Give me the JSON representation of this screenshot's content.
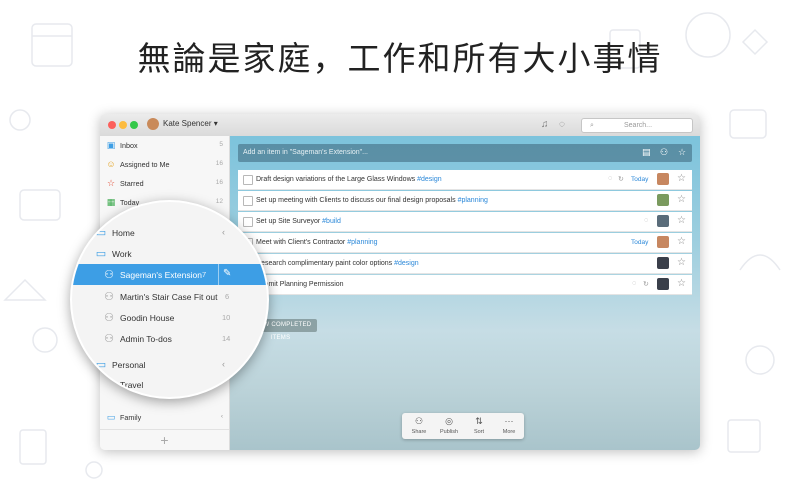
{
  "headline": "無論是家庭，工作和所有大小事情",
  "window": {
    "user": "Kate Spencer",
    "search_placeholder": "Search...",
    "colors": {
      "close": "#fc605c",
      "minimize": "#fdbc40",
      "zoom": "#34c84a",
      "accent": "#3d9ee5",
      "tag": "#2b88d9"
    }
  },
  "sidebar": {
    "items": [
      {
        "label": "Inbox",
        "count": "5",
        "icon": "inbox-icon"
      },
      {
        "label": "Assigned to Me",
        "count": "16",
        "icon": "person-icon"
      },
      {
        "label": "Starred",
        "count": "16",
        "icon": "star-icon"
      },
      {
        "label": "Today",
        "count": "12",
        "icon": "calendar-icon"
      }
    ],
    "bottom": [
      {
        "label": "Family",
        "icon": "folder-icon"
      }
    ],
    "add_label": "+"
  },
  "magnifier": {
    "items": [
      {
        "label": "Home",
        "type": "folder"
      },
      {
        "label": "Work",
        "type": "folder"
      },
      {
        "label": "Sageman's Extension",
        "count": "7",
        "type": "shared-list",
        "selected": true
      },
      {
        "label": "Martin's Stair Case Fit out",
        "count": "6",
        "type": "shared-list"
      },
      {
        "label": "Goodin House",
        "count": "10",
        "type": "shared-list"
      },
      {
        "label": "Admin To-dos",
        "count": "14",
        "type": "shared-list"
      },
      {
        "label": "Personal",
        "type": "folder"
      },
      {
        "label": "Travel",
        "type": "list"
      }
    ]
  },
  "main": {
    "add_placeholder": "Add an item in \"Sageman's Extension\"...",
    "tasks": [
      {
        "text": "Draft design variations of the Large Glass Windows ",
        "tag": "#design",
        "due": "Today",
        "comment": true,
        "repeat": true
      },
      {
        "text": "Set up meeting with Clients to discuss our final design proposals ",
        "tag": "#planning",
        "due": "",
        "comment": false,
        "repeat": false
      },
      {
        "text": "Set up Site Surveyor ",
        "tag": "#build",
        "due": "",
        "comment": true,
        "repeat": false
      },
      {
        "text": "Meet with Client's Contractor ",
        "tag": "#planning",
        "due": "Today",
        "comment": false,
        "repeat": false
      },
      {
        "text": "Research complimentary paint color options ",
        "tag": "#design",
        "due": "",
        "comment": false,
        "repeat": false
      },
      {
        "text": "Submit Planning Permission",
        "tag": "",
        "due": "",
        "comment": true,
        "repeat": true
      }
    ],
    "completed_label": "SHOW COMPLETED ITEMS",
    "toolbar": [
      {
        "label": "Share",
        "icon": "share-icon"
      },
      {
        "label": "Publish",
        "icon": "publish-icon"
      },
      {
        "label": "Sort",
        "icon": "sort-icon"
      },
      {
        "label": "More",
        "icon": "more-icon"
      }
    ]
  }
}
